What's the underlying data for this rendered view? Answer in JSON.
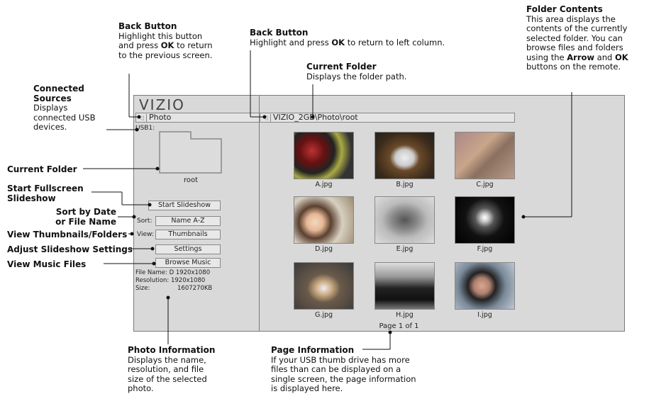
{
  "screen": {
    "logo": "VIZIO",
    "left_path": "Photo",
    "current_path": "VIZIO_2GB\\Photo\\root",
    "source_label": "USB1:",
    "folder_name": "root",
    "buttons": {
      "start_slideshow": "Start Slideshow",
      "sort_label": "Sort:",
      "sort_value": "Name A-Z",
      "view_label": "View:",
      "view_value": "Thumbnails",
      "settings": "Settings",
      "browse_music": "Browse Music"
    },
    "file_info": {
      "name": "File Name: D 1920x1080",
      "resolution": "Resolution: 1920x1080",
      "size_label": "Size:",
      "size_value": "1607270KB"
    },
    "thumbnails": [
      "A.jpg",
      "B.jpg",
      "C.jpg",
      "D.jpg",
      "E.jpg",
      "F.jpg",
      "G.jpg",
      "H.jpg",
      "I.jpg"
    ],
    "page_info": "Page 1 of 1"
  },
  "callouts": {
    "back_button_left": {
      "title": "Back Button",
      "l1": "Highlight this button",
      "l2a": "and press ",
      "l2b": "OK",
      "l2c": " to return",
      "l3": "to the previous screen."
    },
    "back_button_right": {
      "title": "Back Button",
      "l1a": "Highlight and press ",
      "l1b": "OK",
      "l1c": " to return to left column."
    },
    "current_folder_top": {
      "title": "Current Folder",
      "l1": "Displays the folder path."
    },
    "folder_contents": {
      "title": "Folder Contents",
      "l1": "This area displays the",
      "l2": "contents of the currently",
      "l3": "selected folder. You can",
      "l4": "browse files and folders",
      "l5a": "using the ",
      "l5b": "Arrow",
      "l5c": " and ",
      "l5d": "OK",
      "l6": "buttons on the remote."
    },
    "connected_sources": {
      "t1": "Connected",
      "t2": "Sources",
      "l1": "Displays",
      "l2": "connected USB",
      "l3": "devices."
    },
    "current_folder_left": "Current Folder",
    "start_fullscreen": {
      "t1": "Start Fullscreen",
      "t2": "Slideshow"
    },
    "sort_by": {
      "t1": "Sort by Date",
      "t2": "or File Name"
    },
    "view_thumbnails": "View Thumbnails/Folders",
    "adjust_slideshow": "Adjust Slideshow Settings",
    "view_music": "View Music Files",
    "photo_info": {
      "title": "Photo Information",
      "l1": "Displays the name,",
      "l2": "resolution, and file",
      "l3": "size of the selected",
      "l4": "photo."
    },
    "page_info": {
      "title": "Page Information",
      "l1": "If your USB thumb drive has more",
      "l2": "files than can be displayed on a",
      "l3": "single screen, the page information",
      "l4": "is displayed here."
    }
  },
  "colors": {
    "screen_bg": "#d9d9d9",
    "border": "#7a7a7a"
  }
}
